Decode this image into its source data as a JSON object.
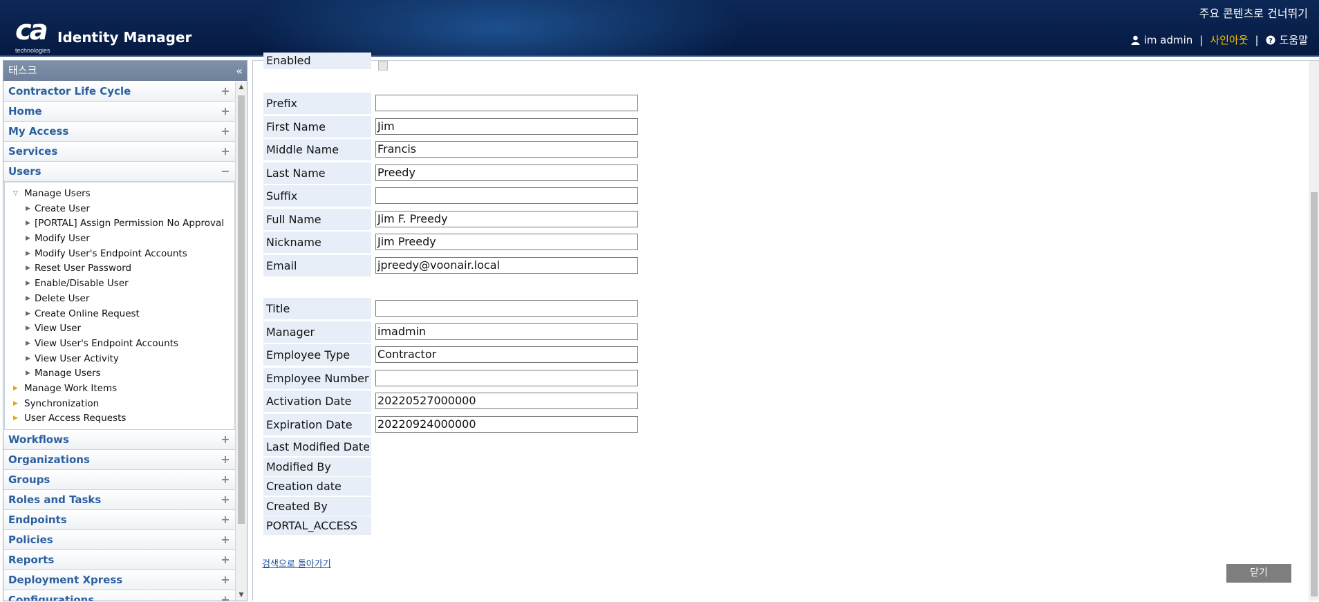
{
  "header": {
    "logo_text": "ca",
    "logo_sub": "technologies",
    "app_title": "Identity Manager",
    "skip_link": "주요 콘텐츠로 건너뛰기",
    "user_name": "im admin",
    "sign_out": "사인아웃",
    "help": "도움말",
    "user_icon": "user-icon",
    "help_icon": "help-icon"
  },
  "sidebar": {
    "title": "태스크",
    "collapse_glyph": "«",
    "categories_top": [
      {
        "label": "Contractor Life Cycle",
        "state": "+"
      },
      {
        "label": "Home",
        "state": "+"
      },
      {
        "label": "My Access",
        "state": "+"
      },
      {
        "label": "Services",
        "state": "+"
      },
      {
        "label": "Users",
        "state": "−"
      }
    ],
    "tree": [
      {
        "label": "Manage Users",
        "level": 1,
        "arrow": "▽",
        "color": "gray"
      },
      {
        "label": "Create User",
        "level": 2,
        "arrow": "▶",
        "color": "gray"
      },
      {
        "label": "[PORTAL] Assign Permission No Approval",
        "level": 2,
        "arrow": "▶",
        "color": "gray"
      },
      {
        "label": "Modify User",
        "level": 2,
        "arrow": "▶",
        "color": "gray"
      },
      {
        "label": "Modify User's Endpoint Accounts",
        "level": 2,
        "arrow": "▶",
        "color": "gray"
      },
      {
        "label": "Reset User Password",
        "level": 2,
        "arrow": "▶",
        "color": "gray"
      },
      {
        "label": "Enable/Disable User",
        "level": 2,
        "arrow": "▶",
        "color": "gray"
      },
      {
        "label": "Delete User",
        "level": 2,
        "arrow": "▶",
        "color": "gray"
      },
      {
        "label": "Create Online Request",
        "level": 2,
        "arrow": "▶",
        "color": "gray"
      },
      {
        "label": "View User",
        "level": 2,
        "arrow": "▶",
        "color": "gray"
      },
      {
        "label": "View User's Endpoint Accounts",
        "level": 2,
        "arrow": "▶",
        "color": "gray"
      },
      {
        "label": "View User Activity",
        "level": 2,
        "arrow": "▶",
        "color": "gray"
      },
      {
        "label": "Manage Users",
        "level": 2,
        "arrow": "▶",
        "color": "gray"
      },
      {
        "label": "Manage Work Items",
        "level": 1,
        "arrow": "▶",
        "color": "orange"
      },
      {
        "label": "Synchronization",
        "level": 1,
        "arrow": "▶",
        "color": "orange"
      },
      {
        "label": "User Access Requests",
        "level": 1,
        "arrow": "▶",
        "color": "orange"
      }
    ],
    "categories_bottom": [
      {
        "label": "Workflows",
        "state": "+"
      },
      {
        "label": "Organizations",
        "state": "+"
      },
      {
        "label": "Groups",
        "state": "+"
      },
      {
        "label": "Roles and Tasks",
        "state": "+"
      },
      {
        "label": "Endpoints",
        "state": "+"
      },
      {
        "label": "Policies",
        "state": "+"
      },
      {
        "label": "Reports",
        "state": "+"
      },
      {
        "label": "Deployment Xpress",
        "state": "+"
      },
      {
        "label": "Configurations",
        "state": "+"
      }
    ]
  },
  "form": {
    "enabled_label": "Enabled",
    "fields": [
      {
        "label": "Prefix",
        "value": ""
      },
      {
        "label": "First Name",
        "value": "Jim"
      },
      {
        "label": "Middle Name",
        "value": "Francis"
      },
      {
        "label": "Last Name",
        "value": "Preedy"
      },
      {
        "label": "Suffix",
        "value": ""
      },
      {
        "label": "Full Name",
        "value": "Jim F. Preedy"
      },
      {
        "label": "Nickname",
        "value": "Jim Preedy"
      },
      {
        "label": "Email",
        "value": "jpreedy@voonair.local"
      }
    ],
    "fields2": [
      {
        "label": "Title",
        "value": ""
      },
      {
        "label": "Manager",
        "value": "imadmin"
      },
      {
        "label": "Employee Type",
        "value": "Contractor"
      },
      {
        "label": "Employee Number",
        "value": ""
      },
      {
        "label": "Activation Date",
        "value": "20220527000000"
      },
      {
        "label": "Expiration Date",
        "value": "20220924000000"
      }
    ],
    "readonly": [
      {
        "label": "Last Modified Date"
      },
      {
        "label": "Modified By"
      },
      {
        "label": "Creation date"
      },
      {
        "label": "Created By"
      },
      {
        "label": "PORTAL_ACCESS"
      }
    ],
    "back_link": "검색으로 돌아가기",
    "close_button": "닫기"
  }
}
